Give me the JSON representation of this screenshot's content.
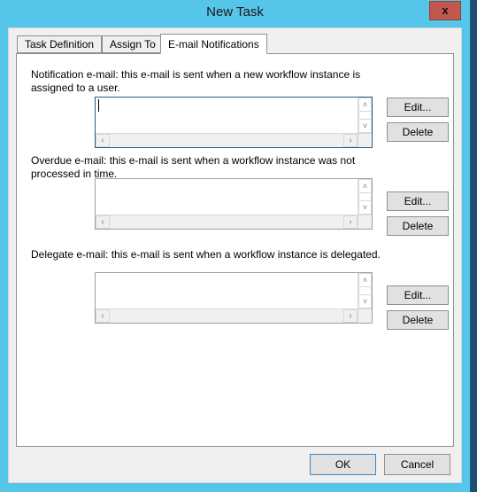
{
  "window": {
    "title": "New Task",
    "close_label": "x",
    "close_icon": "close-icon"
  },
  "tabs": [
    {
      "label": "Task Definition",
      "active": false
    },
    {
      "label": "Assign To",
      "active": false
    },
    {
      "label": "E-mail Notifications",
      "active": true
    }
  ],
  "sections": [
    {
      "id": "notification",
      "label": "Notification e-mail: this e-mail is sent when a new workflow instance is assigned to a user.",
      "value": "",
      "focused": true,
      "edit_label": "Edit...",
      "delete_label": "Delete"
    },
    {
      "id": "overdue",
      "label": "Overdue e-mail: this e-mail is sent when a workflow instance was not processed in time.",
      "value": "",
      "focused": false,
      "edit_label": "Edit...",
      "delete_label": "Delete"
    },
    {
      "id": "delegate",
      "label": "Delegate e-mail: this e-mail is sent when a workflow instance is delegated.",
      "value": "",
      "focused": false,
      "edit_label": "Edit...",
      "delete_label": "Delete"
    }
  ],
  "scrollbars": {
    "up_arrow": "˄",
    "down_arrow": "˅",
    "left_arrow": "‹",
    "right_arrow": "›"
  },
  "footer": {
    "ok_label": "OK",
    "cancel_label": "Cancel"
  },
  "colors": {
    "title_bar": "#56c5ea",
    "close_button": "#c0584f",
    "dialog_bg": "#f0f0f0",
    "panel_bg": "#ffffff",
    "focus_border": "#3d86c6",
    "desktop_edge": "#1f4e79"
  }
}
